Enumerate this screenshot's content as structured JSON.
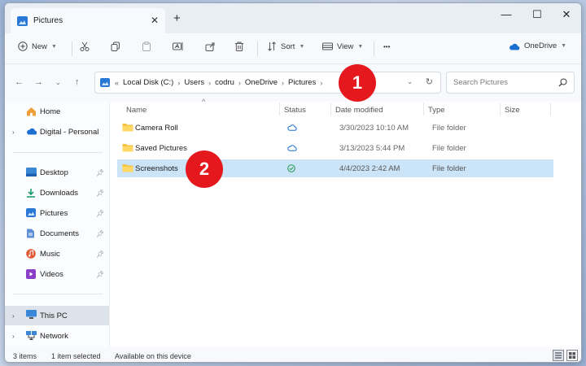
{
  "titlebar": {
    "tab_title": "Pictures",
    "close_glyph": "✕",
    "new_tab_glyph": "+",
    "minimize_glyph": "—",
    "maximize_glyph": "☐",
    "window_close_glyph": "✕"
  },
  "toolbar": {
    "new_label": "New",
    "sort_label": "Sort",
    "view_label": "View",
    "more_glyph": "•••",
    "onedrive_label": "OneDrive"
  },
  "address": {
    "overflow": "«",
    "crumbs": [
      "Local Disk (C:)",
      "Users",
      "codru",
      "OneDrive",
      "Pictures"
    ],
    "separator": "›",
    "search_placeholder": "Search Pictures"
  },
  "sidebar": {
    "home": "Home",
    "digital": "Digital - Personal",
    "quick": [
      "Desktop",
      "Downloads",
      "Pictures",
      "Documents",
      "Music",
      "Videos"
    ],
    "this_pc": "This PC",
    "network": "Network"
  },
  "columns": {
    "name": "Name",
    "status": "Status",
    "date": "Date modified",
    "type": "Type",
    "size": "Size"
  },
  "files": [
    {
      "name": "Camera Roll",
      "status": "cloud",
      "date": "3/30/2023 10:10 AM",
      "type": "File folder"
    },
    {
      "name": "Saved Pictures",
      "status": "cloud",
      "date": "3/13/2023 5:44 PM",
      "type": "File folder"
    },
    {
      "name": "Screenshots",
      "status": "synced",
      "date": "4/4/2023 2:42 AM",
      "type": "File folder"
    }
  ],
  "statusbar": {
    "items": "3 items",
    "selected": "1 item selected",
    "availability": "Available on this device"
  },
  "callouts": [
    "1",
    "2"
  ],
  "colors": {
    "accent": "#0067c0",
    "selection": "#cce4f7",
    "callout": "#e4181d",
    "folder": "#f4c542"
  }
}
